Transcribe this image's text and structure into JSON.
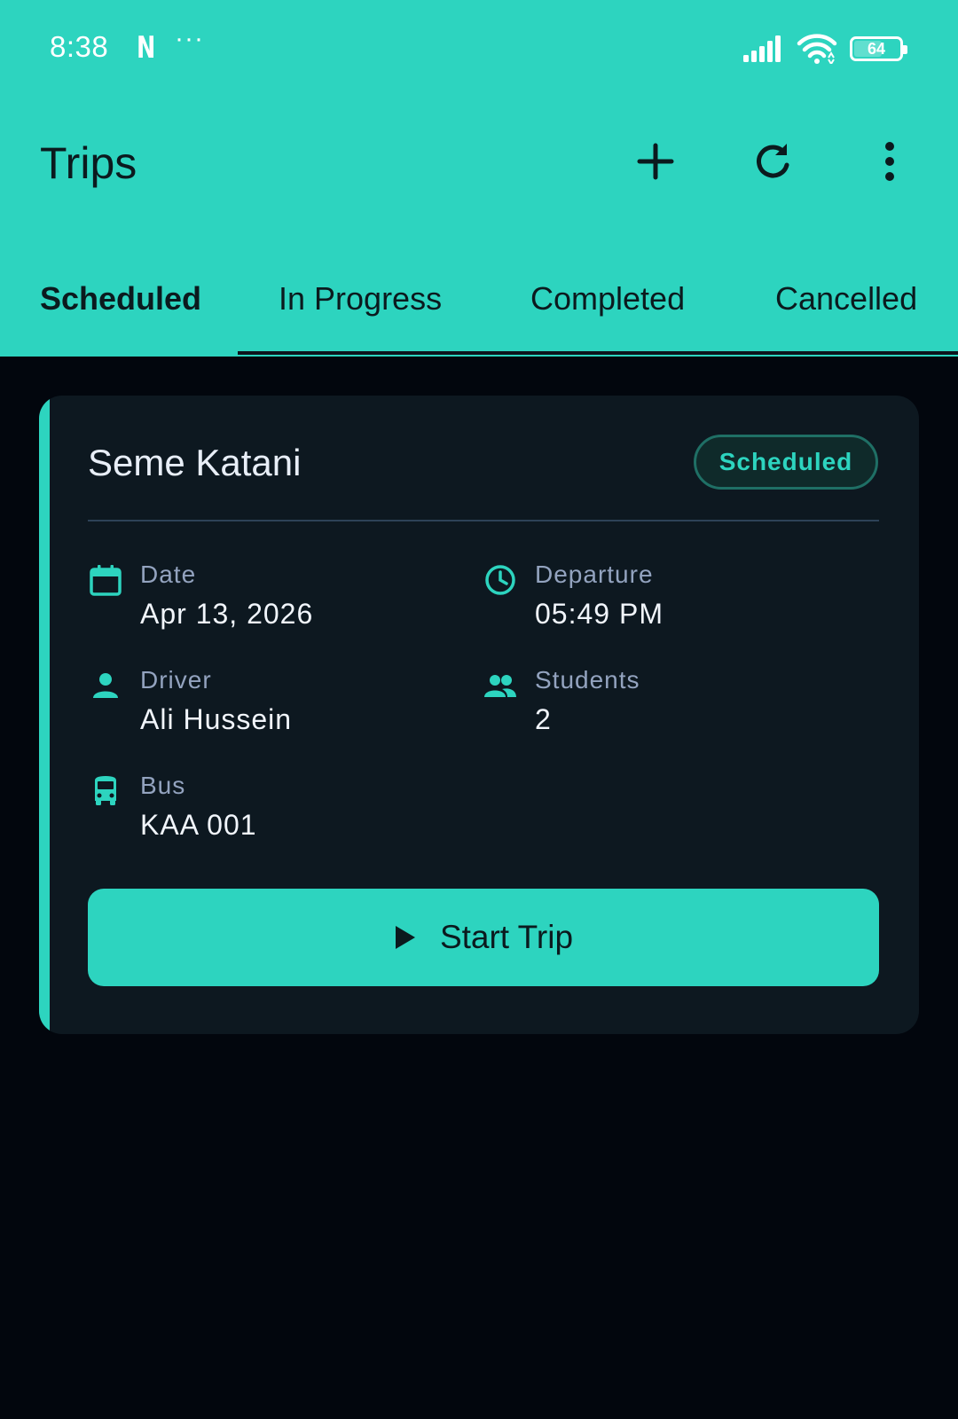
{
  "status_bar": {
    "time": "8:38",
    "notification_letter": "N",
    "more_dots": "···",
    "battery_level": "64",
    "battery_fraction": 0.64
  },
  "app_bar": {
    "title": "Trips",
    "icons": [
      "add-icon",
      "refresh-icon",
      "more-vert-icon"
    ]
  },
  "tabs": [
    {
      "label": "Scheduled",
      "selected": true
    },
    {
      "label": "In Progress",
      "selected": false
    },
    {
      "label": "Completed",
      "selected": false
    },
    {
      "label": "Cancelled",
      "selected": false
    }
  ],
  "trip": {
    "name": "Seme Katani",
    "status": "Scheduled",
    "date_label": "Date",
    "date_value": "Apr 13, 2026",
    "departure_label": "Departure",
    "departure_value": "05:49 PM",
    "driver_label": "Driver",
    "driver_value": "Ali Hussein",
    "students_label": "Students",
    "students_value": "2",
    "bus_label": "Bus",
    "bus_value": "KAA 001",
    "action_label": "Start Trip"
  },
  "colors": {
    "accent": "#2dd4bf",
    "background": "#02060d",
    "card": "#0d1820",
    "label": "#93a3bf"
  }
}
